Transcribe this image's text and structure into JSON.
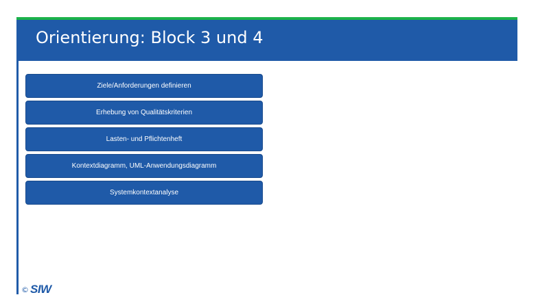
{
  "slide": {
    "title": "Orientierung: Block 3 und 4",
    "steps": [
      "Ziele/Anforderungen definieren",
      "Erhebung von Qualitätskriterien",
      "Lasten- und Pflichtenheft",
      "Kontextdiagramm, UML-Anwendungsdiagramm",
      "Systemkontextanalyse"
    ],
    "footer": {
      "copyright": "©",
      "logo": "SIW"
    }
  },
  "colors": {
    "primary": "#1f5aa8",
    "accent": "#1bb24a",
    "background": "#ffffff",
    "text_on_primary": "#ffffff"
  }
}
